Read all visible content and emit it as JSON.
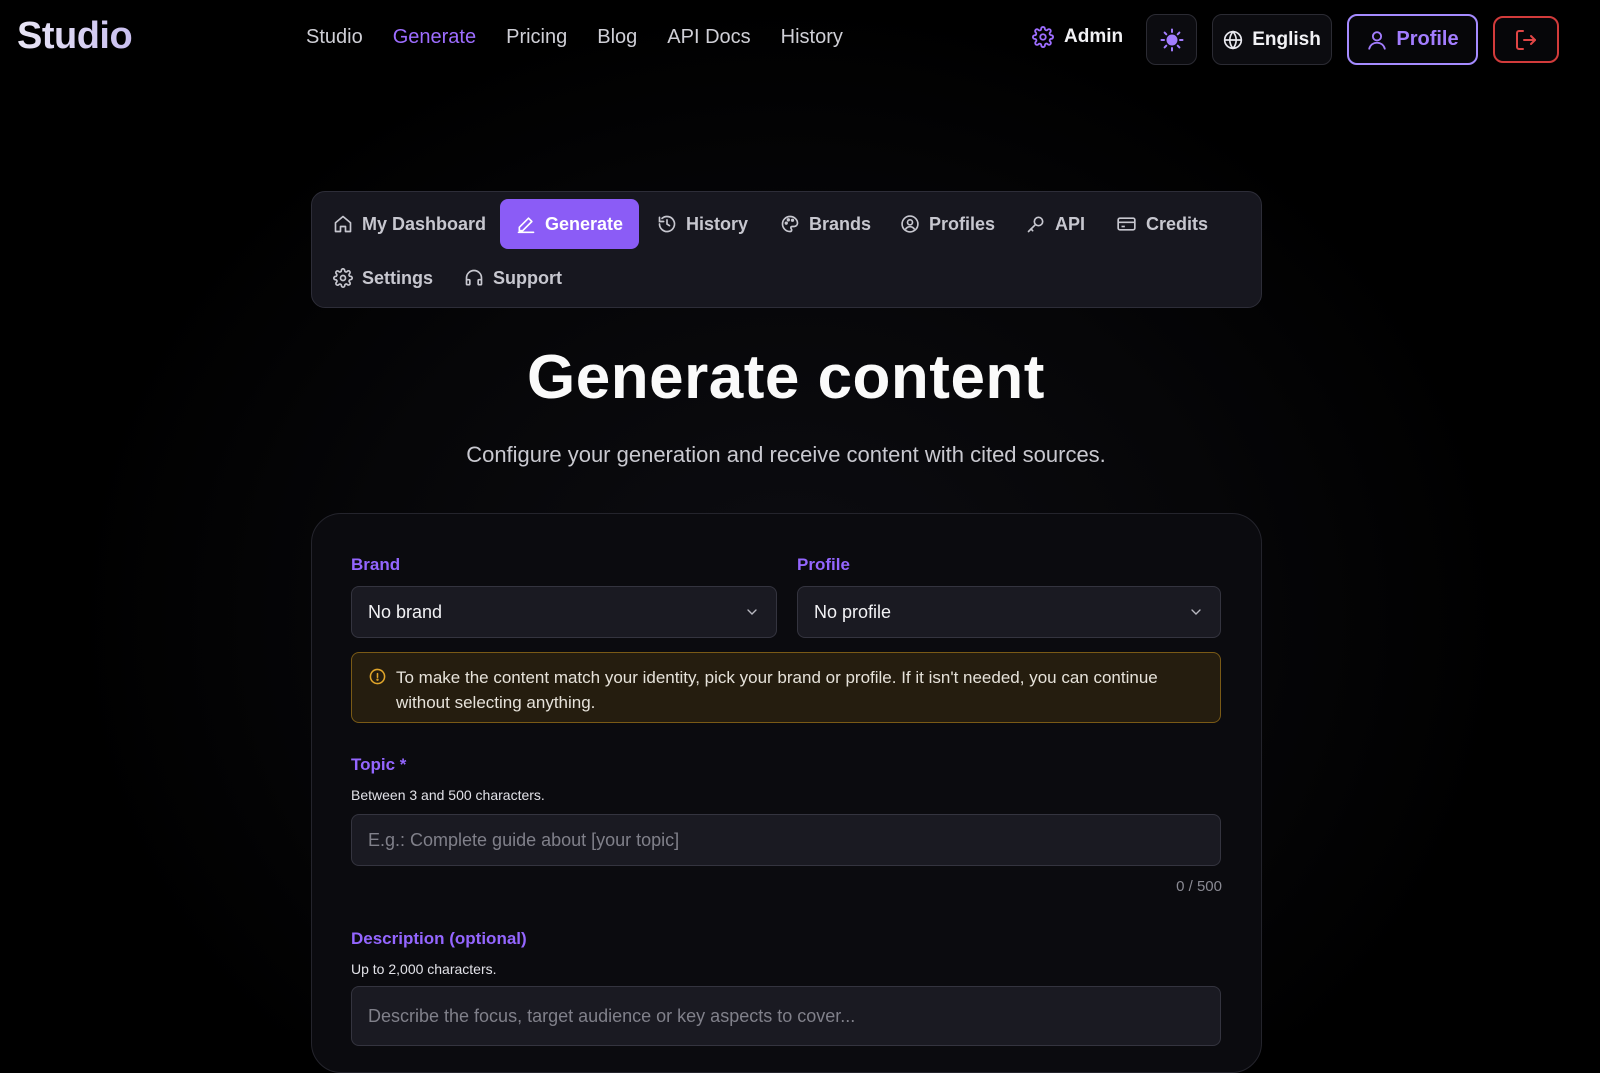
{
  "header": {
    "logo": "Studio",
    "nav": [
      {
        "label": "Studio",
        "active": false
      },
      {
        "label": "Generate",
        "active": true
      },
      {
        "label": "Pricing",
        "active": false
      },
      {
        "label": "Blog",
        "active": false
      },
      {
        "label": "API Docs",
        "active": false
      },
      {
        "label": "History",
        "active": false
      }
    ],
    "admin_label": "Admin",
    "language_label": "English",
    "profile_label": "Profile",
    "theme_icon": "sun-icon",
    "logout_icon": "logout-icon"
  },
  "subnav": {
    "tabs": [
      {
        "label": "My Dashboard",
        "icon": "home-icon",
        "active": false
      },
      {
        "label": "Generate",
        "icon": "pencil-icon",
        "active": true
      },
      {
        "label": "History",
        "icon": "history-icon",
        "active": false
      },
      {
        "label": "Brands",
        "icon": "palette-icon",
        "active": false
      },
      {
        "label": "Profiles",
        "icon": "profile-circle-icon",
        "active": false
      },
      {
        "label": "API",
        "icon": "key-icon",
        "active": false
      },
      {
        "label": "Credits",
        "icon": "card-icon",
        "active": false
      },
      {
        "label": "Settings",
        "icon": "gear-icon",
        "active": false
      },
      {
        "label": "Support",
        "icon": "headset-icon",
        "active": false
      }
    ]
  },
  "main": {
    "title": "Generate content",
    "subtitle": "Configure your generation and receive content with cited sources."
  },
  "form": {
    "brand_label": "Brand",
    "brand_value": "No brand",
    "profile_label": "Profile",
    "profile_value": "No profile",
    "notice": "To make the content match your identity, pick your brand or profile. If it isn't needed, you can continue without selecting anything.",
    "topic_label": "Topic *",
    "topic_hint": "Between 3 and 500 characters.",
    "topic_placeholder": "E.g.: Complete guide about [your topic]",
    "topic_value": "",
    "topic_counter": "0 / 500",
    "description_label": "Description (optional)",
    "description_hint": "Up to 2,000 characters.",
    "description_placeholder": "Describe the focus, target audience or key aspects to cover..."
  },
  "colors": {
    "accent": "#8b5cf6",
    "accent_text": "#9d6dff",
    "danger": "#d23b3b",
    "warning_border": "#7a5a16"
  }
}
